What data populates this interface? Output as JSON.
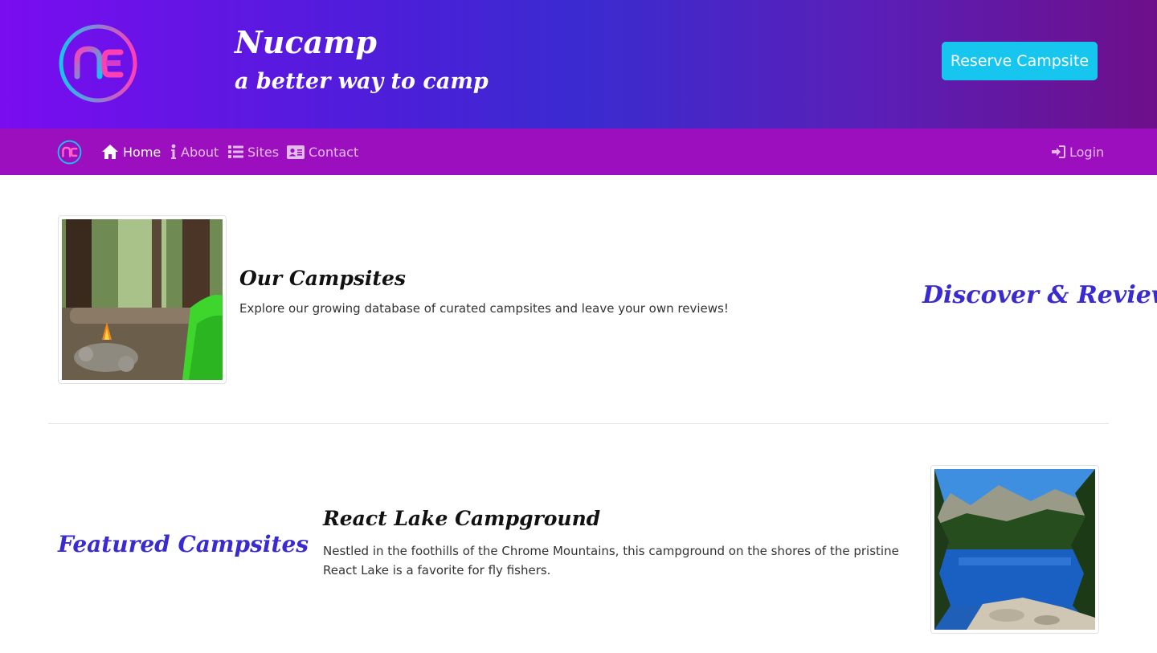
{
  "header": {
    "brand_title": "Nucamp",
    "tagline": "a better way to camp",
    "reserve_label": "Reserve Campsite",
    "logo_icon": "nucamp-logo-icon",
    "colors": {
      "gradient_start": "#7a0cf0",
      "gradient_end": "#6e0f8a",
      "button": "#17c6ee"
    }
  },
  "navbar": {
    "background": "#9c0fbf",
    "items": [
      {
        "label": "Home",
        "icon": "home-icon",
        "active": true
      },
      {
        "label": "About",
        "icon": "info-icon",
        "active": false
      },
      {
        "label": "Sites",
        "icon": "list-icon",
        "active": false
      },
      {
        "label": "Contact",
        "icon": "address-card-icon",
        "active": false
      }
    ],
    "login": {
      "label": "Login",
      "icon": "sign-in-icon"
    }
  },
  "campsites": {
    "heading": "Our Campsites",
    "text": "Explore our growing database of curated campsites and leave your own reviews!",
    "side_heading": "Discover & Review",
    "image": "campfire-forest-image"
  },
  "featured": {
    "side_heading": "Featured Campsites",
    "heading": "React Lake Campground",
    "text": "Nestled in the foothills of the Chrome Mountains, this campground on the shores of the pristine React Lake is a favorite for fly fishers.",
    "image": "mountain-lake-image"
  }
}
